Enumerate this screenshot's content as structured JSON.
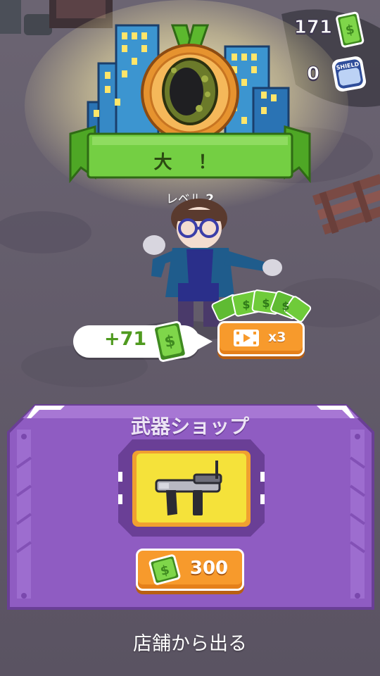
{
  "hud": {
    "cash_count": "171",
    "shield_count": "0",
    "shield_label": "SHIELD",
    "colors": {
      "cash": "#6fcb3a",
      "shield": "#3a5fb0"
    }
  },
  "rank": {
    "title": "大 ！",
    "level_prefix": "レベル",
    "level_number": "2",
    "icons": [
      "medal-icon",
      "skull-mask-icon",
      "city-skyline"
    ]
  },
  "reward": {
    "amount": "+71",
    "multiplier": "x3",
    "icons": [
      "cash-stack-icon",
      "arrow-right-icon",
      "video-ad-icon",
      "cash-pile-icon"
    ]
  },
  "shop": {
    "title": "武器ショップ",
    "item_icon": "submachine-gun-icon",
    "price": "300"
  },
  "footer": {
    "exit_label": "店舗から出る"
  },
  "colors": {
    "accent_orange": "#f79a2c",
    "panel_purple": "#8f5cc2",
    "banner_green": "#6fcb3a",
    "item_yellow": "#f5e23a"
  }
}
